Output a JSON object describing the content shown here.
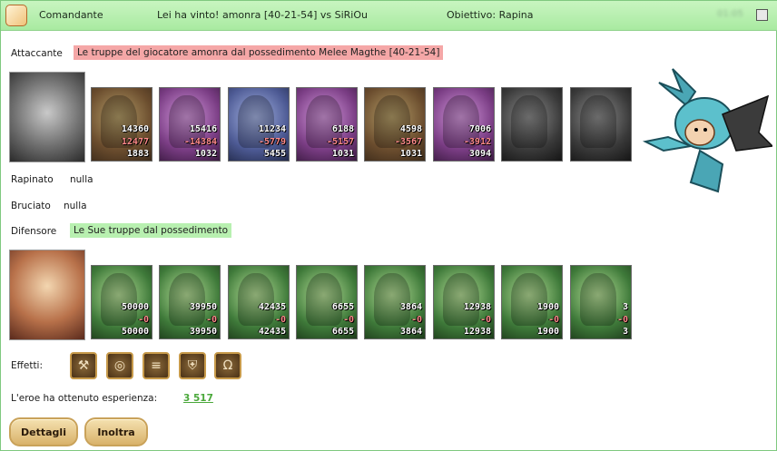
{
  "header": {
    "role": "Comandante",
    "result": "Lei ha vinto! amonra [40-21-54] vs SiRiOu",
    "objective": "Obiettivo: Rapina",
    "time": "01:05"
  },
  "attacker": {
    "label": "Attaccante",
    "banner": "Le truppe del giocatore amonra dal possedimento Melee Magthe [40-21-54]",
    "units": [
      {
        "start": "14360",
        "lost": "12477",
        "left": "1883"
      },
      {
        "start": "15416",
        "lost": "-14384",
        "left": "1032"
      },
      {
        "start": "11234",
        "lost": "-5779",
        "left": "5455"
      },
      {
        "start": "6188",
        "lost": "-5157",
        "left": "1031"
      },
      {
        "start": "4598",
        "lost": "-3567",
        "left": "1031"
      },
      {
        "start": "7006",
        "lost": "-3912",
        "left": "3094"
      },
      {
        "start": "",
        "lost": "",
        "left": ""
      },
      {
        "start": "",
        "lost": "",
        "left": ""
      }
    ]
  },
  "plunder": {
    "label": "Rapinato",
    "value": "nulla"
  },
  "burned": {
    "label": "Bruciato",
    "value": "nulla"
  },
  "defender": {
    "label": "Difensore",
    "banner": "Le Sue truppe dal possedimento",
    "units": [
      {
        "start": "50000",
        "lost": "-0",
        "left": "50000"
      },
      {
        "start": "39950",
        "lost": "-0",
        "left": "39950"
      },
      {
        "start": "42435",
        "lost": "-0",
        "left": "42435"
      },
      {
        "start": "6655",
        "lost": "-0",
        "left": "6655"
      },
      {
        "start": "3864",
        "lost": "-0",
        "left": "3864"
      },
      {
        "start": "12938",
        "lost": "-0",
        "left": "12938"
      },
      {
        "start": "1900",
        "lost": "-0",
        "left": "1900"
      },
      {
        "start": "3",
        "lost": "-0",
        "left": "3"
      }
    ]
  },
  "effects": {
    "label": "Effetti:",
    "icons": [
      "axe-icon",
      "ring-icon",
      "scroll-icon",
      "shield-icon",
      "horseshoe-icon"
    ]
  },
  "experience": {
    "label": "L'eroe ha ottenuto esperienza:",
    "value": "3 517"
  },
  "buttons": {
    "details": "Dettagli",
    "forward": "Inoltra"
  },
  "colors": {
    "header_bg": "#b2ecaa",
    "attacker_banner": "#f5a7a7",
    "defender_banner": "#b8f0b0",
    "xp_link": "#4aa83a"
  }
}
